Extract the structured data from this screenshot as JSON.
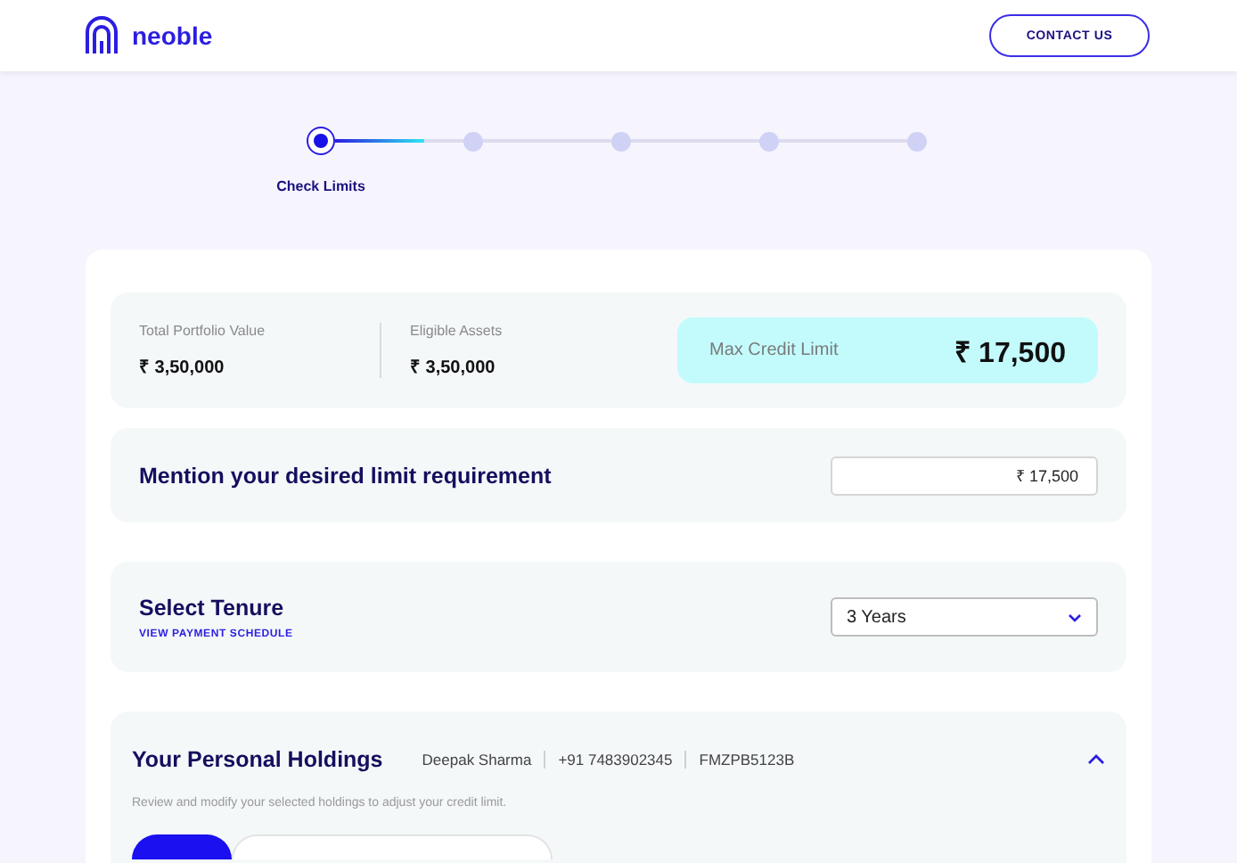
{
  "header": {
    "brand": "neoble",
    "contact_button": "CONTACT US"
  },
  "steps": [
    {
      "label": "Check Limits",
      "selected": true
    },
    {
      "selected": false
    },
    {
      "selected": false
    },
    {
      "selected": false
    },
    {
      "selected": false
    }
  ],
  "summary": {
    "total_portfolio": {
      "label": "Total Portfolio Value",
      "value": "₹ 3,50,000"
    },
    "eligible_assets": {
      "label": "Eligible Assets",
      "value": "₹ 3,50,000"
    },
    "max_credit": {
      "label": "Max Credit Limit",
      "value": "₹ 17,500"
    }
  },
  "desired_limit": {
    "label": "Mention your desired limit requirement",
    "value": "₹ 17,500"
  },
  "tenure": {
    "label": "Select Tenure",
    "link": "VIEW PAYMENT SCHEDULE",
    "value": "3 Years"
  },
  "holdings": {
    "title": "Your Personal Holdings",
    "name": "Deepak Sharma",
    "phone": "+91 7483902345",
    "pan": "FMZPB5123B",
    "expanded": true,
    "description": "Review and modify your selected holdings to adjust your credit limit.",
    "toggle": [
      {
        "selected": true
      },
      {
        "selected": false
      }
    ]
  }
}
